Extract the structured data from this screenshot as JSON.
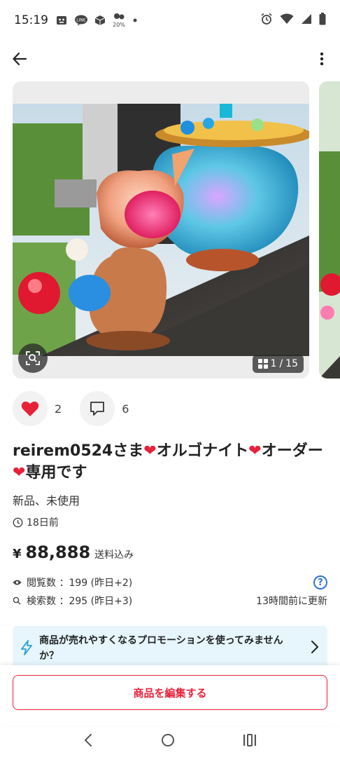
{
  "status_bar": {
    "time": "15:19",
    "left_icons": [
      "face-notify-icon",
      "line-icon",
      "box-icon",
      "percent-badge-icon",
      "dot-icon"
    ],
    "right_icons": [
      "alarm-icon",
      "wifi-icon",
      "cell-signal-icon",
      "battery-icon"
    ]
  },
  "app_bar": {
    "back_icon": "arrow-left-icon",
    "more_icon": "more-vert-icon"
  },
  "gallery": {
    "current": "1",
    "separator": "/",
    "total": "15"
  },
  "reactions": {
    "likes": "2",
    "comments": "6"
  },
  "item": {
    "title_part1": "reirem0524さま",
    "title_part2": "オルゴナイト",
    "title_part3": "オーダー",
    "title_part4": "専用です",
    "heart": "❤",
    "condition": "新品、未使用",
    "posted": "18日前"
  },
  "price": {
    "currency": "¥",
    "amount": "88,888",
    "shipping": "送料込み"
  },
  "stats": {
    "views": "閲覧数 ：199 (昨日+2)",
    "searches": "検索数 ：295 (昨日+3)",
    "updated": "13時間前に更新",
    "help": "?"
  },
  "promo": {
    "text": "商品が売れやすくなるプロモーションを使ってみませんか？"
  },
  "edit_button": {
    "label": "商品を編集する"
  },
  "colors": {
    "accent_red": "#e8213a",
    "link_blue": "#2f74d6",
    "promo_bg": "#e6f6fc"
  }
}
